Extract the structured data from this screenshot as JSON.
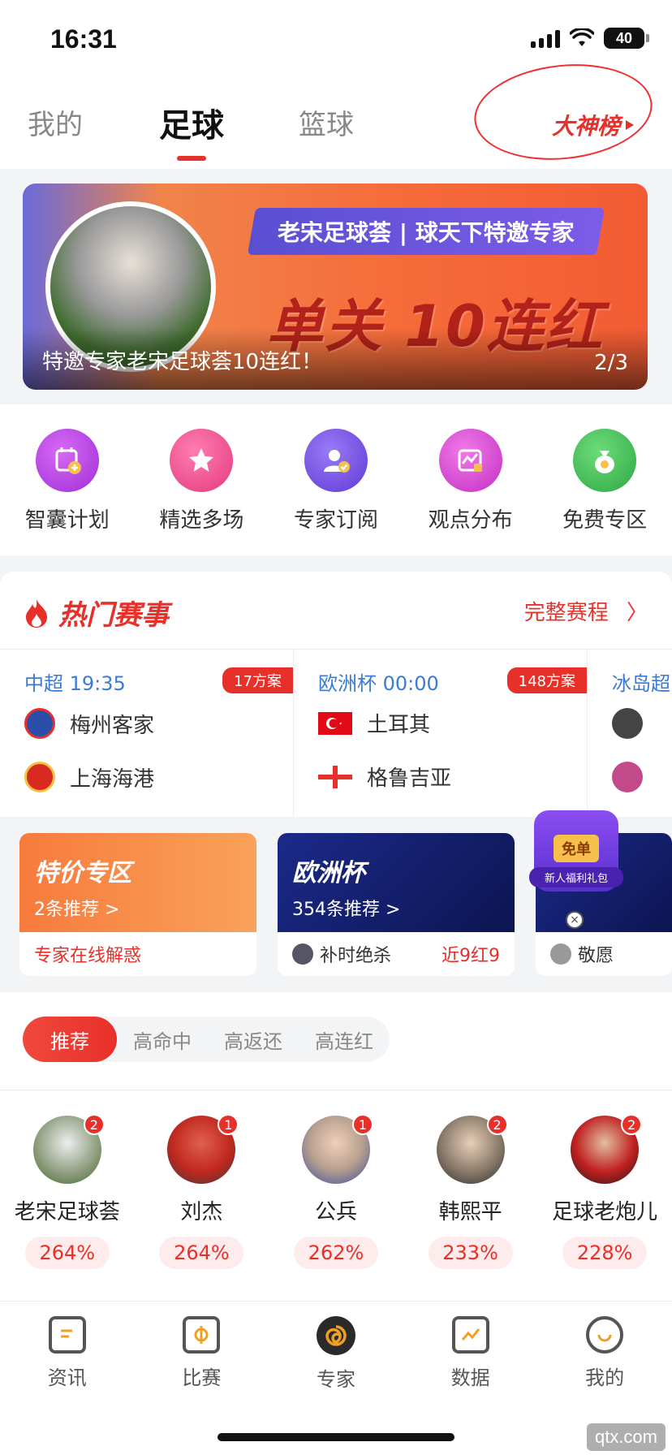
{
  "status": {
    "time": "16:31",
    "battery": "40"
  },
  "tabs": [
    {
      "label": "我的"
    },
    {
      "label": "足球"
    },
    {
      "label": "篮球"
    }
  ],
  "rank": {
    "label": "大神榜"
  },
  "banner": {
    "pill_text": "老宋足球荟 | 球天下特邀专家",
    "big_text": "单关 10连红",
    "caption": "特邀专家老宋足球荟10连红！",
    "page": "2/3"
  },
  "quick": [
    {
      "label": "智囊计划",
      "color": "#b43ae0"
    },
    {
      "label": "精选多场",
      "color": "#f04f8c"
    },
    {
      "label": "专家订阅",
      "color": "#7448e0"
    },
    {
      "label": "观点分布",
      "color": "#d43ad0"
    },
    {
      "label": "免费专区",
      "color": "#34b64a"
    }
  ],
  "hot": {
    "title": "热门赛事",
    "full_schedule": "完整赛程",
    "matches": [
      {
        "league": "中超 19:35",
        "count": "17方案",
        "home": "梅州客家",
        "away": "上海海港"
      },
      {
        "league": "欧洲杯 00:00",
        "count": "148方案",
        "home": "土耳其",
        "away": "格鲁吉亚"
      },
      {
        "league": "冰岛超",
        "count": "",
        "home": "",
        "away": ""
      }
    ]
  },
  "promos": [
    {
      "title": "特价专区",
      "sub": "2条推荐 >",
      "foot": "专家在线解惑",
      "extra": ""
    },
    {
      "title": "欧洲杯",
      "sub": "354条推荐 >",
      "foot": "补时绝杀",
      "extra": "近9红9"
    },
    {
      "title": "",
      "sub": "",
      "foot": "敬愿",
      "extra": ""
    }
  ],
  "gift": {
    "tag": "免单",
    "label": "新人福利礼包"
  },
  "filters": [
    {
      "label": "推荐"
    },
    {
      "label": "高命中"
    },
    {
      "label": "高返还"
    },
    {
      "label": "高连红"
    }
  ],
  "experts": [
    {
      "name": "老宋足球荟",
      "rate": "264%",
      "badge": "2"
    },
    {
      "name": "刘杰",
      "rate": "264%",
      "badge": "1"
    },
    {
      "name": "公兵",
      "rate": "262%",
      "badge": "1"
    },
    {
      "name": "韩熙平",
      "rate": "233%",
      "badge": "2"
    },
    {
      "name": "足球老炮儿",
      "rate": "228%",
      "badge": "2"
    }
  ],
  "nav": [
    {
      "label": "资讯"
    },
    {
      "label": "比赛"
    },
    {
      "label": "专家"
    },
    {
      "label": "数据"
    },
    {
      "label": "我的"
    }
  ],
  "watermark": "qtx.com"
}
